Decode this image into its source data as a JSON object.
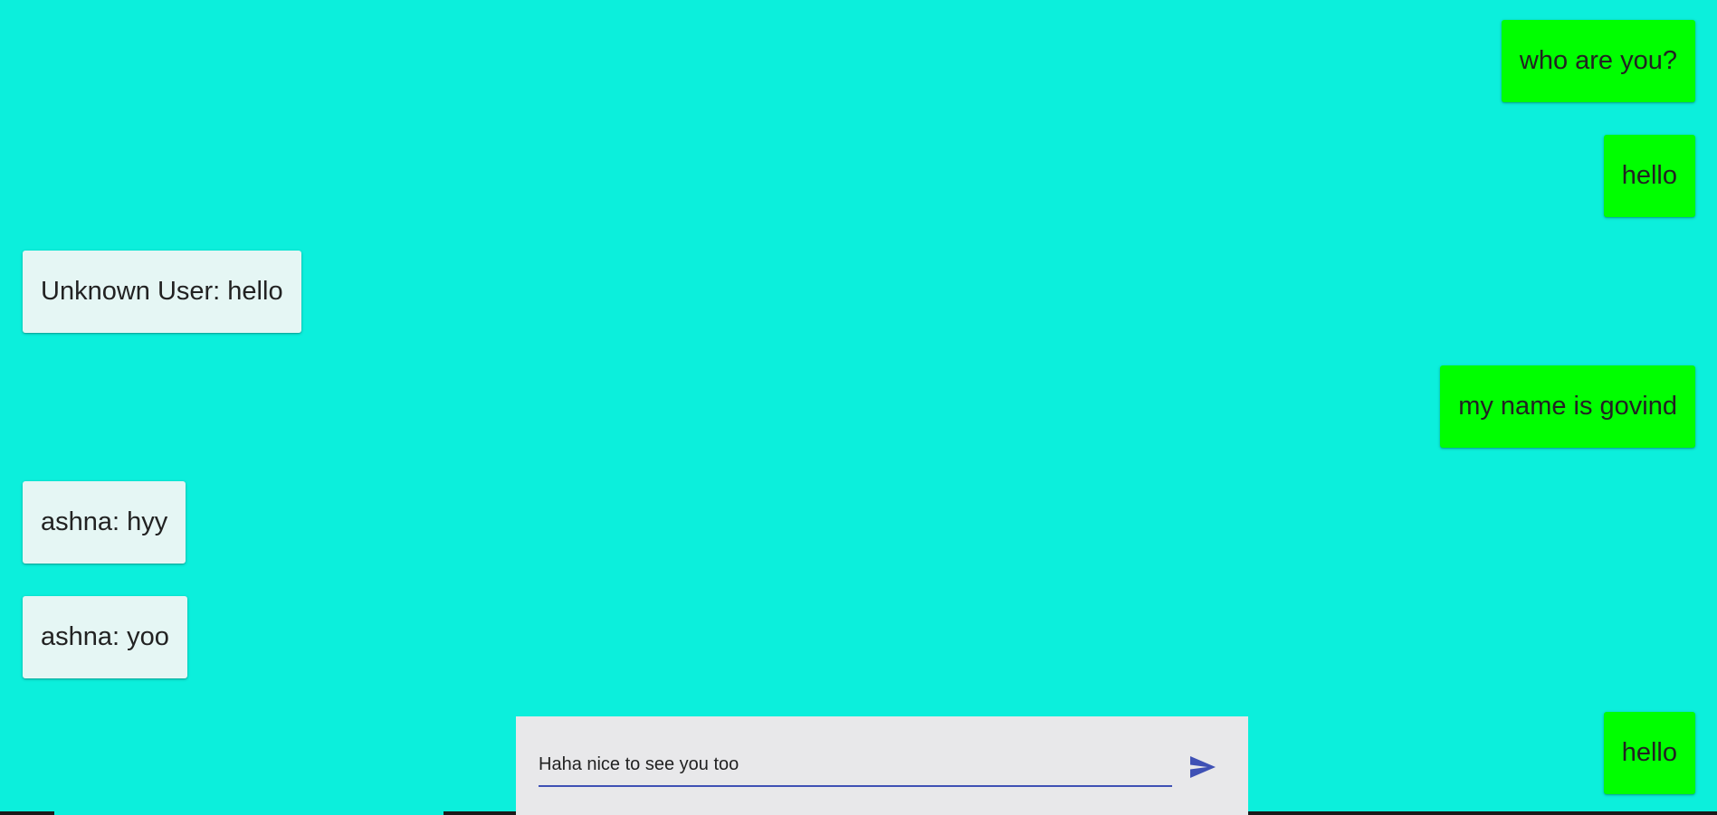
{
  "messages": [
    {
      "text": "who are you?",
      "direction": "sent"
    },
    {
      "text": "hello",
      "direction": "sent"
    },
    {
      "text": "Unknown User: hello",
      "direction": "received"
    },
    {
      "text": "my name is govind",
      "direction": "sent"
    },
    {
      "text": "ashna: hyy",
      "direction": "received"
    },
    {
      "text": "ashna: yoo",
      "direction": "received"
    },
    {
      "text": "hello",
      "direction": "sent"
    }
  ],
  "composer": {
    "value": "Haha nice to see you too",
    "send_icon": "send-icon"
  },
  "colors": {
    "background": "#0cefdc",
    "sent_bubble": "#00ff00",
    "received_bubble": "#e5f6f4",
    "composer_bg": "#e8e8ea",
    "accent": "#3f51b5"
  }
}
